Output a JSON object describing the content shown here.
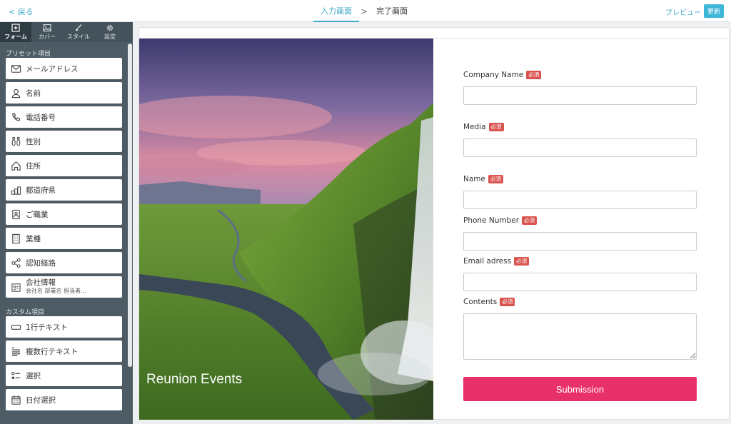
{
  "topbar": {
    "back_label": "< 戻る",
    "steps": [
      "入力画面",
      "完了画面"
    ],
    "step_separator": ">",
    "preview_label": "プレビュー",
    "update_label": "更新"
  },
  "sidebar": {
    "tabs": [
      {
        "label": "フォーム",
        "icon": "plus-square-icon",
        "active": true
      },
      {
        "label": "カバー",
        "icon": "image-icon",
        "active": false
      },
      {
        "label": "スタイル",
        "icon": "brush-icon",
        "active": false
      },
      {
        "label": "設定",
        "icon": "gear-icon",
        "active": false
      }
    ],
    "preset_heading": "プリセット項目",
    "preset_items": [
      {
        "label": "メールアドレス",
        "icon": "mail-icon"
      },
      {
        "label": "名前",
        "icon": "person-icon"
      },
      {
        "label": "電話番号",
        "icon": "phone-icon"
      },
      {
        "label": "性別",
        "icon": "gender-icon"
      },
      {
        "label": "住所",
        "icon": "home-icon"
      },
      {
        "label": "都道府県",
        "icon": "map-buildings-icon"
      },
      {
        "label": "ご職業",
        "icon": "badge-icon"
      },
      {
        "label": "業種",
        "icon": "building-icon"
      },
      {
        "label": "認知経路",
        "icon": "share-icon"
      },
      {
        "label": "会社情報",
        "sub": "会社名 部署名 担当者...",
        "icon": "company-card-icon"
      }
    ],
    "custom_heading": "カスタム項目",
    "custom_items": [
      {
        "label": "1行テキスト",
        "icon": "single-line-icon"
      },
      {
        "label": "複数行テキスト",
        "icon": "multi-line-icon"
      },
      {
        "label": "選択",
        "icon": "list-select-icon"
      },
      {
        "label": "日付選択",
        "icon": "calendar-icon"
      }
    ]
  },
  "canvas": {
    "hero_title": "Reunion Events",
    "fields": [
      {
        "label": "Company Name",
        "required": "必須",
        "type": "input"
      },
      {
        "label": "Media",
        "required": "必須",
        "type": "input"
      },
      {
        "label": "Name",
        "required": "必須",
        "type": "input"
      },
      {
        "label": "Phone Number",
        "required": "必須",
        "type": "input"
      },
      {
        "label": "Email adress",
        "required": "必須",
        "type": "input"
      },
      {
        "label": "Contents",
        "required": "必須",
        "type": "textarea"
      }
    ],
    "submit_label": "Submission"
  },
  "colors": {
    "accent": "#3fa9c7",
    "sidebar_bg": "#4d5b65",
    "required_badge": "#d9534f",
    "submit": "#e8306a"
  }
}
